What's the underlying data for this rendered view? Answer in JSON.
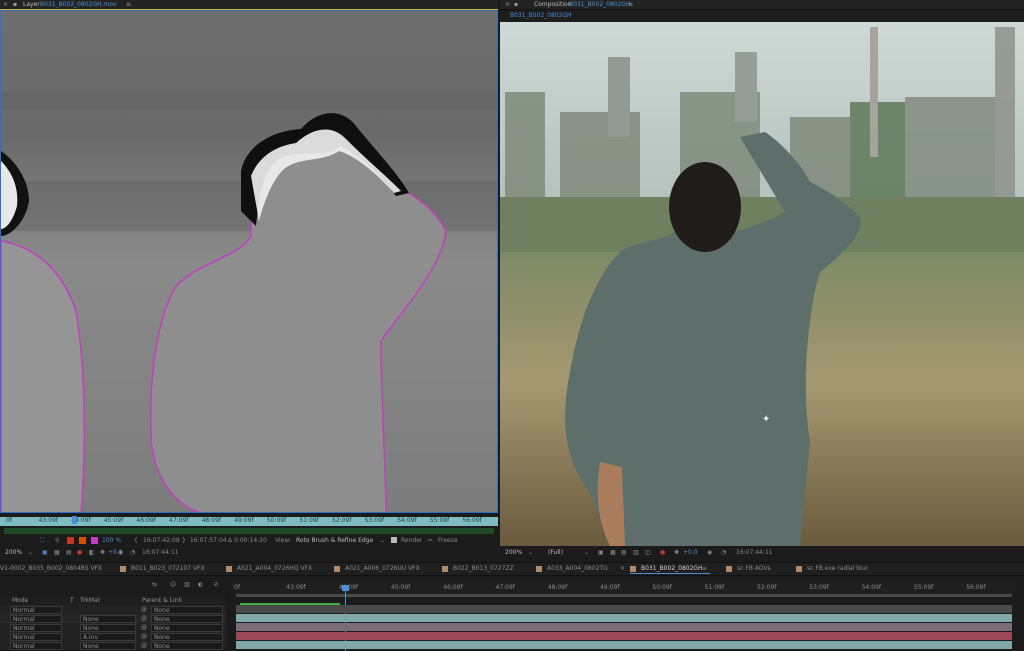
{
  "layer_panel": {
    "label": "Layer",
    "filename": "B031_B002_0802GH.mov",
    "ruler_ticks": [
      "0f",
      "43:09f",
      "44:09f",
      "45:09f",
      "46:09f",
      "47:09f",
      "48:09f",
      "49:09f",
      "50:09f",
      "51:09f",
      "52:09f",
      "53:09f",
      "54:09f",
      "55:09f",
      "56:09f"
    ],
    "zoom": "200%",
    "exposure": "100 %",
    "time_in": "16:07:42:09",
    "time_out": "16:07:57:04",
    "duration": "Δ 0:00:14:20",
    "view_label": "View:",
    "view_value": "Roto Brush & Refine Edge",
    "render_label": "Render",
    "freeze_label": "Freeze",
    "current_time": "16:07:44:11",
    "offset": "+0.0"
  },
  "comp_panel": {
    "label": "Composition",
    "name": "B031_B002_0802GH",
    "tab": "B031_B002_0802GH",
    "zoom": "200%",
    "resolution": "(Full)",
    "current_time": "16:07:44:11",
    "offset": "+0.0"
  },
  "comp_tabs": [
    {
      "label": "V1-0002_B035_B002_0804BS VFX"
    },
    {
      "label": "B011_B023_072107 VFX"
    },
    {
      "label": "A021_A004_0726HQ VFX"
    },
    {
      "label": "A021_A006_0726UU VFX"
    },
    {
      "label": "B022_B013_0727ZZ"
    },
    {
      "label": "A033_A004_0802TG"
    },
    {
      "label": "B031_B002_0802GH"
    },
    {
      "label": "sc FB AOVs"
    },
    {
      "label": "sc FB.exe radial blur"
    }
  ],
  "timeline": {
    "ruler_ticks": [
      "0f",
      "43:09f",
      "44:09f",
      "45:09f",
      "46:09f",
      "47:09f",
      "48:09f",
      "49:09f",
      "50:09f",
      "51:09f",
      "52:09f",
      "53:09f",
      "54:09f",
      "55:09f",
      "56:09f"
    ],
    "headers": {
      "mode": "Mode",
      "t": "T",
      "trkmat": "TrkMat",
      "parent": "Parent & Link"
    },
    "layers": [
      {
        "mode": "Normal",
        "trkmat": "",
        "parent": "None"
      },
      {
        "mode": "Normal",
        "trkmat": "None",
        "parent": "None"
      },
      {
        "mode": "Normal",
        "trkmat": "None",
        "parent": "None"
      },
      {
        "mode": "Normal",
        "trkmat": "A.Inv",
        "parent": "None"
      },
      {
        "mode": "Normal",
        "trkmat": "None",
        "parent": "None"
      }
    ]
  },
  "colors": {
    "accent": "#2b70c9",
    "roto_outline": "#c040c0",
    "ruler": "#7fbcc0",
    "track_teal": "#7fa8a6",
    "track_red": "#9a4a58"
  }
}
